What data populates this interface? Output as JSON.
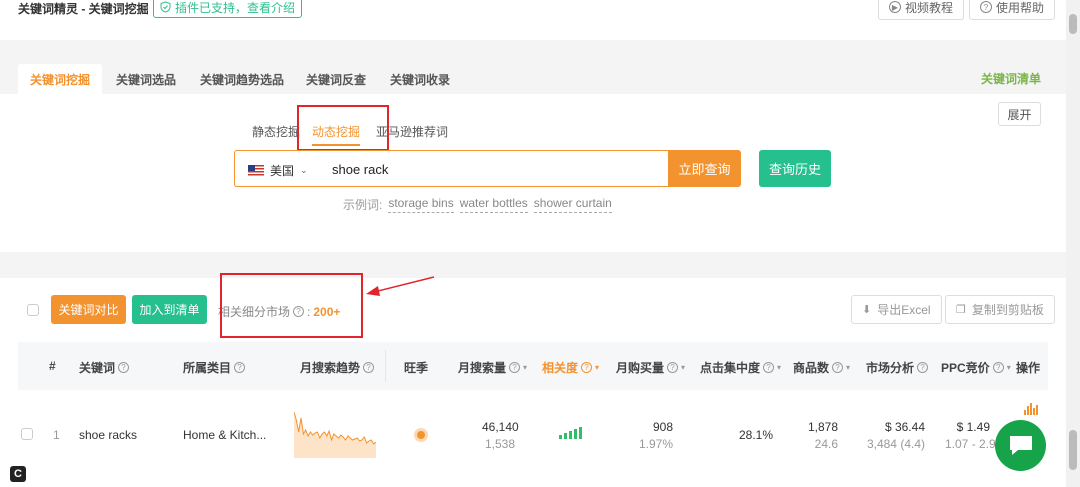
{
  "header": {
    "title": "关键词精灵 - 关键词挖掘",
    "plugin_badge": "插件已支持，查看介绍",
    "video_tutorial": "视频教程",
    "help": "使用帮助"
  },
  "main_tabs": [
    {
      "label": "关键词挖掘",
      "active": true
    },
    {
      "label": "关键词选品",
      "active": false
    },
    {
      "label": "关键词趋势选品",
      "active": false
    },
    {
      "label": "关键词反查",
      "active": false
    },
    {
      "label": "关键词收录",
      "active": false
    }
  ],
  "keyword_list_link": "关键词清单",
  "expand_label": "展开",
  "sub_tabs": [
    {
      "label": "静态挖掘",
      "active": false
    },
    {
      "label": "动态挖掘",
      "active": true
    },
    {
      "label": "亚马逊推荐词",
      "active": false
    }
  ],
  "search": {
    "country": "美国",
    "value": "shoe rack",
    "query_button": "立即查询",
    "history_button": "查询历史",
    "examples_label": "示例词:",
    "examples": [
      "storage bins",
      "water bottles",
      "shower curtain"
    ]
  },
  "toolbar": {
    "compare_button": "关键词对比",
    "add_list_button": "加入到清单",
    "submarket_label": "相关细分市场",
    "submarket_count": "200+",
    "export_button": "导出Excel",
    "copy_button": "复制到剪贴板"
  },
  "table": {
    "headers": {
      "index": "#",
      "keyword": "关键词",
      "category": "所属类目",
      "trend": "月搜索趋势",
      "peak": "旺季",
      "search_volume": "月搜索量",
      "relevance": "相关度",
      "purchases": "月购买量",
      "click_concentration": "点击集中度",
      "products": "商品数",
      "market": "市场分析",
      "ppc": "PPC竞价",
      "actions": "操作"
    },
    "rows": [
      {
        "index": "1",
        "keyword": "shoe racks",
        "category": "Home & Kitch...",
        "search_volume": "46,140",
        "search_volume_sub": "1,538",
        "relevance_level": 5,
        "purchases": "908",
        "purchases_rate": "1.97%",
        "click_concentration": "28.1%",
        "products": "1,878",
        "products_sub": "24.6",
        "market_price": "$ 36.44",
        "market_sub": "3,484 (4.4)",
        "ppc": "$ 1.49",
        "ppc_range": "1.07 - 2.9"
      }
    ]
  },
  "colors": {
    "accent": "#f39330",
    "green": "#25c08d",
    "annotation_red": "#e0262c"
  }
}
